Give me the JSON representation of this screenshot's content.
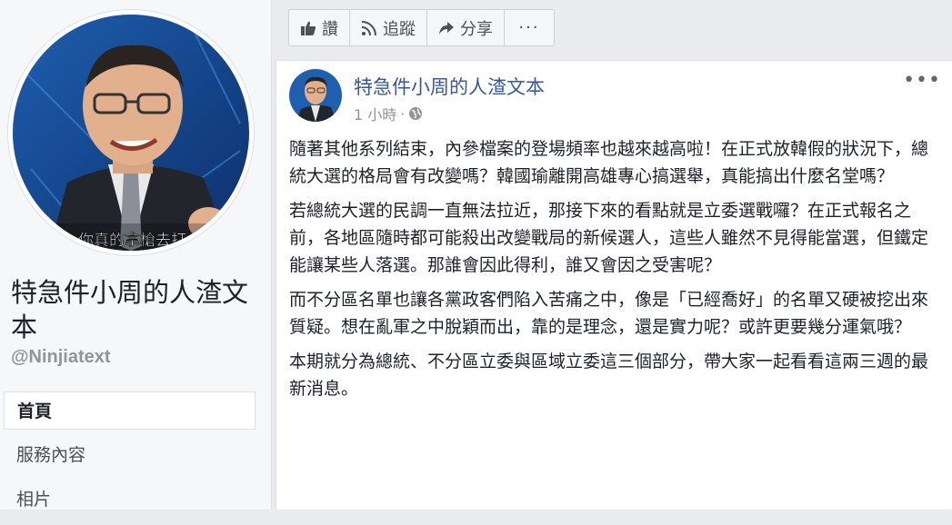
{
  "sidebar": {
    "page_name": "特急件小周的人渣文本",
    "handle": "@Ninjiatext",
    "avatar_caption": "你真的拿槍去打",
    "nav": [
      {
        "label": "首頁",
        "active": true
      },
      {
        "label": "服務內容",
        "active": false
      },
      {
        "label": "相片",
        "active": false
      }
    ]
  },
  "actionbar": {
    "like": "讚",
    "follow": "追蹤",
    "share": "分享",
    "more": "···"
  },
  "post": {
    "author": "特急件小周的人渣文本",
    "time": "1 小時",
    "separator": "·",
    "more": "•••",
    "paragraphs": [
      "隨著其他系列結束，內參檔案的登場頻率也越來越高啦！在正式放韓假的狀況下，總統大選的格局會有改變嗎？韓國瑜離開高雄專心搞選舉，真能搞出什麼名堂嗎？",
      "若總統大選的民調一直無法拉近，那接下來的看點就是立委選戰囉？在正式報名之前，各地區隨時都可能殺出改變戰局的新候選人，這些人雖然不見得能當選，但鐵定能讓某些人落選。那誰會因此得利，誰又會因之受害呢？",
      "而不分區名單也讓各黨政客們陷入苦痛之中，像是「已經喬好」的名單又硬被挖出來質疑。想在亂軍之中脫穎而出，靠的是理念，還是實力呢？或許更要幾分運氣哦？",
      "本期就分為總統、不分區立委與區域立委這三個部分，帶大家一起看看這兩三週的最新消息。"
    ]
  },
  "colors": {
    "link": "#365899",
    "text": "#1d2129",
    "muted": "#90949c",
    "background": "#e9ebee"
  }
}
